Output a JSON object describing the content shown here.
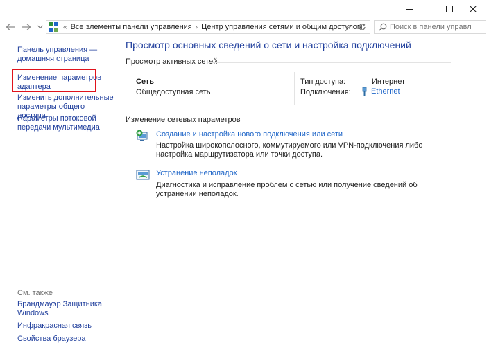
{
  "window": {
    "controls": {
      "minimize": "minimize",
      "maximize": "maximize",
      "close": "close"
    }
  },
  "address": {
    "crumb_root": "Все элементы панели управления",
    "crumb_current": "Центр управления сетями и общим доступом"
  },
  "search": {
    "placeholder": "Поиск в панели управления"
  },
  "sidebar": {
    "home": "Панель управления — домашняя страница",
    "adapter": "Изменение параметров адаптера",
    "sharing": "Изменить дополнительные параметры общего доступа",
    "media": "Параметры потоковой передачи мультимедиа",
    "see_also": "См. также",
    "firewall": "Брандмауэр Защитника Windows",
    "infrared": "Инфракрасная связь",
    "browser": "Свойства браузера"
  },
  "main": {
    "title": "Просмотр основных сведений о сети и настройка подключений",
    "active_label": "Просмотр активных сетей",
    "network_name": "Сеть",
    "network_type": "Общедоступная сеть",
    "access_label": "Тип доступа:",
    "access_value": "Интернет",
    "connections_label": "Подключения:",
    "connections_value": "Ethernet",
    "change_label": "Изменение сетевых параметров",
    "tasks": [
      {
        "title": "Создание и настройка нового подключения или сети",
        "desc": "Настройка широкополосного, коммутируемого или VPN-подключения либо настройка маршрутизатора или точки доступа."
      },
      {
        "title": "Устранение неполадок",
        "desc": "Диагностика и исправление проблем с сетью или получение сведений об устранении неполадок."
      }
    ]
  },
  "colors": {
    "link": "#1f3e9c",
    "task_link": "#1f66c8",
    "highlight_box": "#e0131c"
  }
}
